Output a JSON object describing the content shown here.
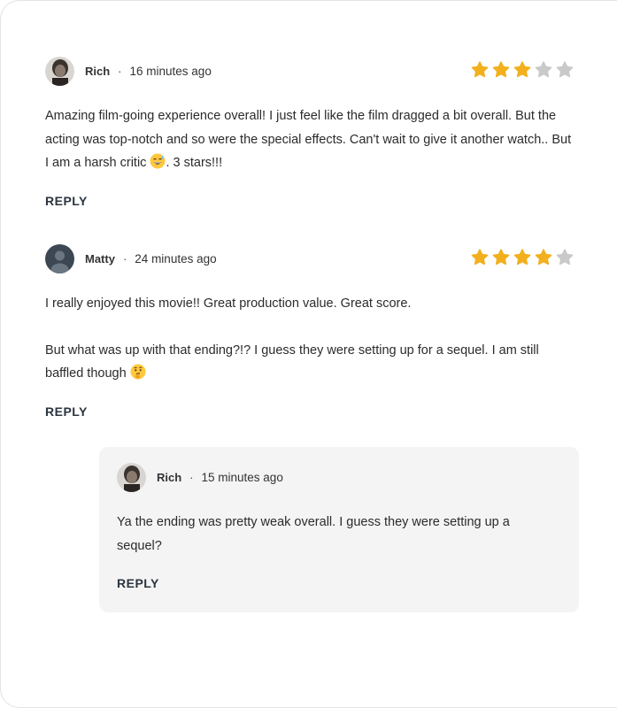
{
  "comments": [
    {
      "author": "Rich",
      "separator": "·",
      "time": "16 minutes ago",
      "rating": 3,
      "rating_max": 5,
      "body_before_emoji": "Amazing film-going experience overall! I just feel like the film dragged a bit overall. But the acting was top-notch and so were the special effects. Can't wait to give it another watch.. But I am a harsh critic ",
      "emoji": "grinning-sweat-emoji",
      "body_after_emoji": ". 3 stars!!!",
      "reply_label": "REPLY",
      "avatar": "photo-avatar"
    },
    {
      "author": "Matty",
      "separator": "·",
      "time": "24 minutes ago",
      "rating": 4,
      "rating_max": 5,
      "paragraph1": "I really enjoyed this movie!! Great production value. Great score.",
      "paragraph2_before_emoji": "But what was up with that ending?!? I guess they were setting up for a sequel. I am still baffled though ",
      "emoji": "thinking-face-emoji",
      "reply_label": "REPLY",
      "avatar": "default-user-avatar"
    }
  ],
  "reply": {
    "author": "Rich",
    "separator": "·",
    "time": "15 minutes ago",
    "body": "Ya the ending was pretty weak overall. I guess they were setting up a sequel?",
    "reply_label": "REPLY",
    "avatar": "photo-avatar"
  },
  "colors": {
    "star_filled": "#F2B01E",
    "star_empty": "#C9C9C9",
    "reply_bg": "#F4F4F4",
    "reply_text": "#2B3440"
  }
}
